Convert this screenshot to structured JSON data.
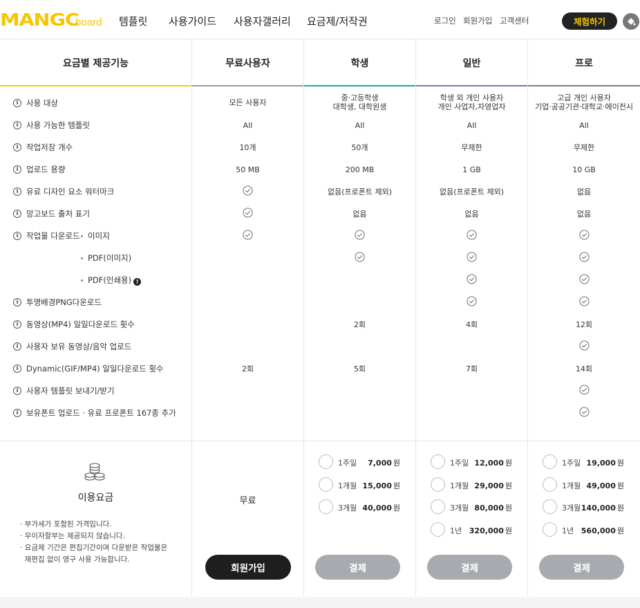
{
  "header": {
    "logo_main": "MANGC",
    "logo_sub": "board",
    "nav": [
      "템플릿",
      "사용가이드",
      "사용자갤러리",
      "요금제/저작권"
    ],
    "util": [
      "로그인",
      "회원가입",
      "고객센터"
    ],
    "trial_button": "체험하기",
    "palette_icon": "paint-bucket-icon"
  },
  "table": {
    "header_feature": "요금별 제공기능",
    "plans": [
      {
        "name": "무료사용자",
        "color": "#9a9a9a"
      },
      {
        "name": "학생",
        "color": "#16a9a4"
      },
      {
        "name": "일반",
        "color": "#8a6fa0"
      },
      {
        "name": "프로",
        "color": "#8a7a63"
      }
    ],
    "header_feature_color": "#e8cf1c",
    "rows": [
      {
        "label": "사용 대상",
        "values": [
          [
            "모든 사용자"
          ],
          [
            "중·고등학생",
            "대학생, 대학원생"
          ],
          [
            "학생 외 개인 사용자",
            "개인 사업자,자영업자"
          ],
          [
            "고급 개인 사용자",
            "기업·공공기관·대학교·에이전시"
          ]
        ]
      },
      {
        "label": "사용 가능한 템플릿",
        "values": [
          [
            "All"
          ],
          [
            "All"
          ],
          [
            "All"
          ],
          [
            "All"
          ]
        ]
      },
      {
        "label": "작업저장 개수",
        "values": [
          [
            "10개"
          ],
          [
            "50개"
          ],
          [
            "무제한"
          ],
          [
            "무제한"
          ]
        ]
      },
      {
        "label": "업로드 용량",
        "values": [
          [
            "50 MB"
          ],
          [
            "200 MB"
          ],
          [
            "1 GB"
          ],
          [
            "10 GB"
          ]
        ]
      },
      {
        "label": "유료 디자인 요소 워터마크",
        "values": [
          [
            "✓"
          ],
          [
            "없음(프로폰트 제외)"
          ],
          [
            "없음(프로폰트 제외)"
          ],
          [
            "없음"
          ]
        ]
      },
      {
        "label": "망고보드 출처 표기",
        "values": [
          [
            "✓"
          ],
          [
            "없음"
          ],
          [
            "없음"
          ],
          [
            "없음"
          ]
        ]
      },
      {
        "label": "작업물 다운로드",
        "sub": "이미지",
        "values": [
          [
            "✓"
          ],
          [
            "✓"
          ],
          [
            "✓"
          ],
          [
            "✓"
          ]
        ]
      },
      {
        "label": "",
        "sub": "PDF(이미지)",
        "values": [
          [
            ""
          ],
          [
            "✓"
          ],
          [
            "✓"
          ],
          [
            "✓"
          ]
        ]
      },
      {
        "label": "",
        "sub": "PDF(인쇄용)",
        "warn": "!",
        "values": [
          [
            ""
          ],
          [
            ""
          ],
          [
            "✓"
          ],
          [
            "✓"
          ]
        ]
      },
      {
        "label": "투명배경PNG다운로드",
        "values": [
          [
            ""
          ],
          [
            ""
          ],
          [
            "✓"
          ],
          [
            "✓"
          ]
        ]
      },
      {
        "label": "동영상(MP4) 일일다운로드 횟수",
        "values": [
          [
            ""
          ],
          [
            "2회"
          ],
          [
            "4회"
          ],
          [
            "12회"
          ]
        ]
      },
      {
        "label": "사용자 보유 동영상/음악 업로드",
        "values": [
          [
            ""
          ],
          [
            ""
          ],
          [
            ""
          ],
          [
            "✓"
          ]
        ]
      },
      {
        "label": "Dynamic(GIF/MP4) 일일다운로드 횟수",
        "values": [
          [
            "2회"
          ],
          [
            "5회"
          ],
          [
            "7회"
          ],
          [
            "14회"
          ]
        ]
      },
      {
        "label": "사용자 템플릿 보내기/받기",
        "values": [
          [
            ""
          ],
          [
            ""
          ],
          [
            ""
          ],
          [
            "✓"
          ]
        ]
      },
      {
        "label": "보유폰트 업로드 · 유료 프로폰트 167종 추가",
        "values": [
          [
            ""
          ],
          [
            ""
          ],
          [
            ""
          ],
          [
            "✓"
          ]
        ]
      }
    ]
  },
  "pricing": {
    "title": "이용요금",
    "notes": [
      "· 부가세가 포함된 가격입니다.",
      "· 무이자할부는 제공되지 않습니다.",
      "· 요금제 기간은 편집기간이며 다운받은 작업물은",
      "  재편집 없이 영구 사용 가능합니다."
    ],
    "free_label": "무료",
    "signup_button": "회원가입",
    "pay_button": "결제",
    "currency": "원",
    "student": [
      {
        "period": "1주일",
        "price": "7,000"
      },
      {
        "period": "1개월",
        "price": "15,000"
      },
      {
        "period": "3개월",
        "price": "40,000"
      }
    ],
    "general": [
      {
        "period": "1주일",
        "price": "12,000"
      },
      {
        "period": "1개월",
        "price": "29,000"
      },
      {
        "period": "3개월",
        "price": "80,000"
      },
      {
        "period": "1년",
        "price": "320,000"
      }
    ],
    "pro": [
      {
        "period": "1주일",
        "price": "19,000"
      },
      {
        "period": "1개월",
        "price": "49,000"
      },
      {
        "period": "3개월",
        "price": "140,000"
      },
      {
        "period": "1년",
        "price": "560,000"
      }
    ]
  }
}
